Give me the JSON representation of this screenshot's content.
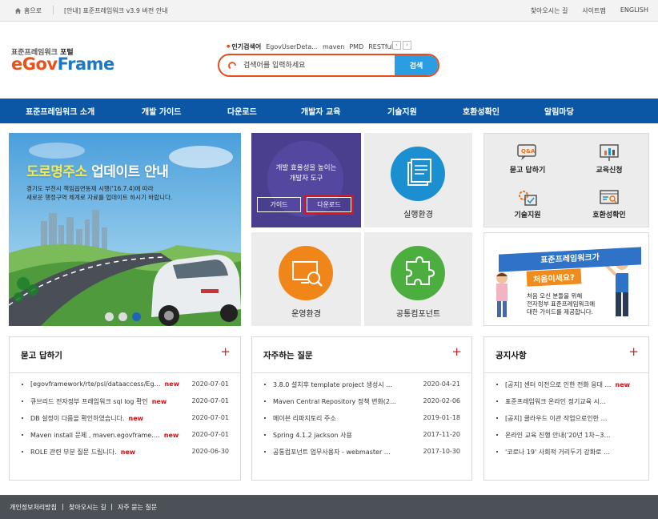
{
  "topbar": {
    "home": "홈으로",
    "notice": "[안내] 표준프레임워크 v3.9 버전 안내",
    "links": [
      "찾아오시는 길",
      "사이트맵",
      "ENGLISH"
    ]
  },
  "logo": {
    "sub_a": "표준프레임워크",
    "sub_b": "포털",
    "main_a": "eGov",
    "main_b": "Frame"
  },
  "popular": {
    "label": "인기검색어",
    "items": [
      "EgovUserDeta...",
      "maven",
      "PMD",
      "RESTful"
    ]
  },
  "search": {
    "placeholder": "검색어를 입력하세요",
    "button": "검색"
  },
  "gnb": [
    "표준프레임워크 소개",
    "개발 가이드",
    "다운로드",
    "개발자 교육",
    "기술지원",
    "호환성확인",
    "알림마당"
  ],
  "banner": {
    "title_a": "도로명주소",
    "title_b": "업데이트 안내",
    "line1": "경기도 부천시 책임읍면동제 시행('16.7.4)에 따라",
    "line2": "새로운 행정구역 체계로 자료를 업데이트 하시기 바랍니다."
  },
  "devtool": {
    "line1": "개발 효율성을 높이는",
    "line2": "개발자 도구",
    "guide": "가이드",
    "download": "다운로드"
  },
  "tiles": {
    "exec": "실행환경",
    "ops": "운영환경",
    "common": "공통컴포넌트"
  },
  "quick": [
    "묻고 답하기",
    "교육신청",
    "기술지원",
    "호환성확인"
  ],
  "firstvisit": {
    "banner": "표준프레임워크가",
    "sub": "처음이세요?",
    "line1": "처음 오신 분들을 위해",
    "line2": "전자정부 표준프레임워크에",
    "line3": "대한 가이드를 제공합니다."
  },
  "qna": {
    "title": "묻고 답하기",
    "rows": [
      {
        "title": "[egovframework/rte/psl/dataaccess/Eg…",
        "new": "new",
        "date": "2020-07-01"
      },
      {
        "title": "큐브리드 전자정부 프레임워크 sql log 확인",
        "new": "new",
        "date": "2020-07-01"
      },
      {
        "title": "DB 설정이 다름을 확인하였습니다.",
        "new": "new",
        "date": "2020-07-01"
      },
      {
        "title": "Maven install 문제 , maven.egovframe.…",
        "new": "new",
        "date": "2020-07-01"
      },
      {
        "title": "ROLE 관련 부분 질문 드립니다.",
        "new": "new",
        "date": "2020-06-30"
      }
    ]
  },
  "faq": {
    "title": "자주하는 질문",
    "rows": [
      {
        "title": "3.8.0 설치후 template project 생성시 …",
        "date": "2020-04-21"
      },
      {
        "title": "Maven Central Repository 정책 변화(2…",
        "date": "2020-02-06"
      },
      {
        "title": "메이븐 리파지토리 주소",
        "date": "2019-01-18"
      },
      {
        "title": "Spring 4.1.2 jackson 사용",
        "date": "2017-11-20"
      },
      {
        "title": "공통컴포넌트 업무사용자 - webmaster …",
        "date": "2017-10-30"
      }
    ]
  },
  "notices": {
    "title": "공지사항",
    "rows": [
      {
        "title": "[공지] 센터 이전으로 인한 전화 응대 …",
        "new": "new"
      },
      {
        "title": "표준프레임워크 온라인 정기교육 시…"
      },
      {
        "title": "[공지] 클라우드 이관 작업으로인한 …"
      },
      {
        "title": "온라인 교육 진행 안내('20년 1차~3…"
      },
      {
        "title": "'코로나 19' 사회적 거리두기 강화로 …"
      }
    ]
  },
  "footer": [
    "개인정보처리방침",
    "찾아오시는 길",
    "자주 묻는 질문"
  ],
  "colors": {
    "gnb": "#0c57a5",
    "accent": "#e74d1b",
    "search": "#2a9de3",
    "purple": "#4a3f8f"
  }
}
